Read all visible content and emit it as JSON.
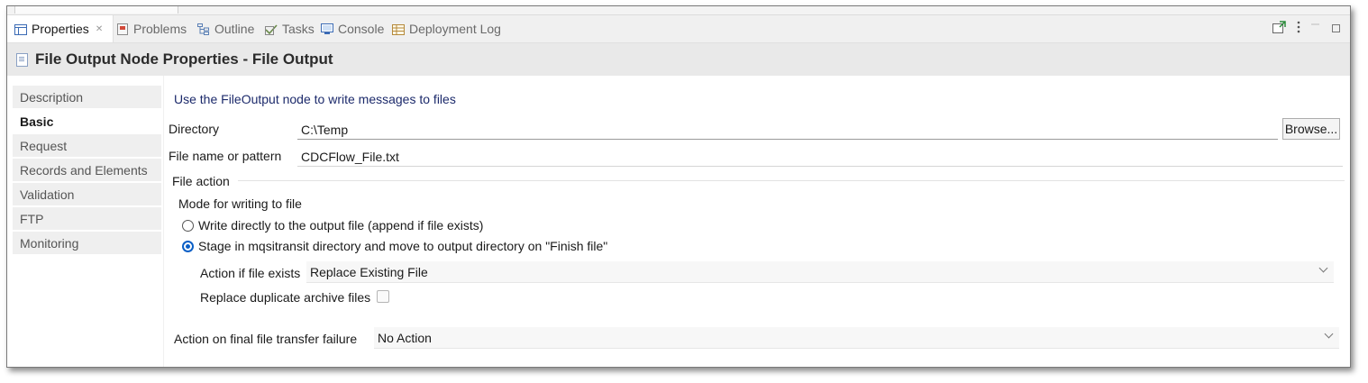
{
  "tabs": [
    {
      "label": "Properties",
      "icon": "properties-icon",
      "active": true,
      "close": "✕"
    },
    {
      "label": "Problems",
      "icon": "problems-icon"
    },
    {
      "label": "Outline",
      "icon": "outline-icon"
    },
    {
      "label": "Tasks",
      "icon": "tasks-icon"
    },
    {
      "label": "Console",
      "icon": "console-icon"
    },
    {
      "label": "Deployment Log",
      "icon": "deployment-log-icon"
    }
  ],
  "header": {
    "title": "File Output Node Properties - File Output"
  },
  "sidebar": {
    "items": [
      {
        "label": "Description"
      },
      {
        "label": "Basic",
        "active": true
      },
      {
        "label": "Request"
      },
      {
        "label": "Records and Elements"
      },
      {
        "label": "Validation"
      },
      {
        "label": "FTP"
      },
      {
        "label": "Monitoring"
      }
    ]
  },
  "content": {
    "description": "Use the FileOutput node to write messages to files",
    "directory": {
      "label": "Directory",
      "value": "C:\\Temp",
      "browse_label": "Browse..."
    },
    "filename": {
      "label": "File name or pattern",
      "value": "CDCFlow_File.txt"
    },
    "file_action": {
      "group_label": "File action",
      "mode_label": "Mode for writing to file",
      "radio_direct": "Write directly to the output file (append if file exists)",
      "radio_stage": "Stage in mqsitransit directory and move to output directory on \"Finish file\"",
      "selected": "stage",
      "action_if_exists_label": "Action if file exists",
      "action_if_exists_value": "Replace Existing File",
      "replace_duplicate_label": "Replace duplicate archive files",
      "replace_duplicate_checked": false
    },
    "transfer_failure": {
      "label": "Action on final file transfer failure",
      "value": "No Action"
    }
  },
  "colors": {
    "accent": "#0a5fc6",
    "description_text": "#1c2a6b"
  }
}
